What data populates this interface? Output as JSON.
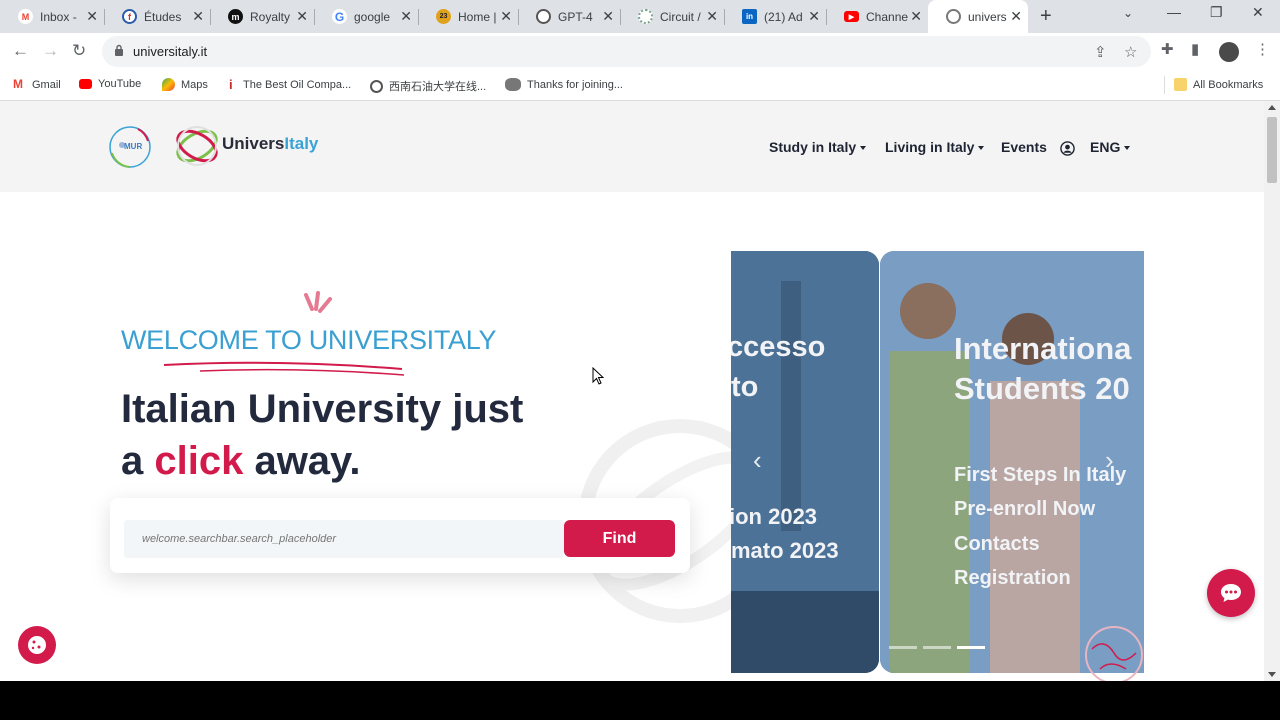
{
  "browser": {
    "tabs": [
      {
        "label": "Inbox -",
        "icon": "gmail-icon",
        "color": "#ea4335",
        "glyph": "M"
      },
      {
        "label": "Études",
        "icon": "etudes-icon",
        "color": "#2a5caa",
        "glyph": "é"
      },
      {
        "label": "Royalty",
        "icon": "medium-icon",
        "color": "#111111",
        "glyph": "m"
      },
      {
        "label": "google",
        "icon": "google-icon",
        "color": "#4285f4",
        "glyph": "G"
      },
      {
        "label": "Home |",
        "icon": "home-icon",
        "color": "#e0a21b",
        "glyph": "23"
      },
      {
        "label": "GPT-4",
        "icon": "openai-icon",
        "color": "#444444",
        "glyph": "◎"
      },
      {
        "label": "Circuit /",
        "icon": "circuit-icon",
        "color": "#7aa38c",
        "glyph": "◌"
      },
      {
        "label": "(21) Ad",
        "icon": "linkedin-icon",
        "color": "#0a66c2",
        "glyph": "in"
      },
      {
        "label": "Channe",
        "icon": "youtube-icon",
        "color": "#ff0000",
        "glyph": "▶"
      },
      {
        "label": "univers",
        "icon": "universitaly-icon",
        "color": "#888888",
        "glyph": "◎"
      }
    ],
    "url": "universitaly.it",
    "bookmarks": [
      {
        "label": "Gmail",
        "icon": "gmail-icon"
      },
      {
        "label": "YouTube",
        "icon": "youtube-icon"
      },
      {
        "label": "Maps",
        "icon": "maps-icon"
      },
      {
        "label": "The Best Oil Compa...",
        "icon": "info-icon"
      },
      {
        "label": "西南石油大学在线...",
        "icon": "globe-icon"
      },
      {
        "label": "Thanks for joining...",
        "icon": "raccoon-icon"
      }
    ],
    "all_bookmarks": "All Bookmarks"
  },
  "site": {
    "brand_prefix": "Univers",
    "brand_suffix": "Italy",
    "mur_label": "MUR",
    "nav": {
      "study": "Study in Italy",
      "living": "Living in Italy",
      "events": "Events",
      "lang": "ENG"
    },
    "hero": {
      "welcome": "WELCOME TO UNIVERSITALY",
      "line1": "Italian University just",
      "line2_a": "a ",
      "line2_click": "click",
      "line2_b": " away."
    },
    "search": {
      "placeholder": "welcome.searchbar.search_placeholder",
      "button": "Find"
    },
    "carousel": {
      "left": {
        "title_1": "ccesso",
        "title_2": "to",
        "link_1": "ion 2023",
        "link_2": "mato 2023"
      },
      "right": {
        "title_1": "Internationa",
        "title_2": "Students 20",
        "links": [
          "First Steps In Italy",
          "Pre-enroll Now",
          "Contacts",
          "Registration"
        ]
      }
    }
  },
  "colors": {
    "accent": "#d21a4b",
    "welcome_blue": "#3a9fd1",
    "heading": "#232a3d"
  }
}
